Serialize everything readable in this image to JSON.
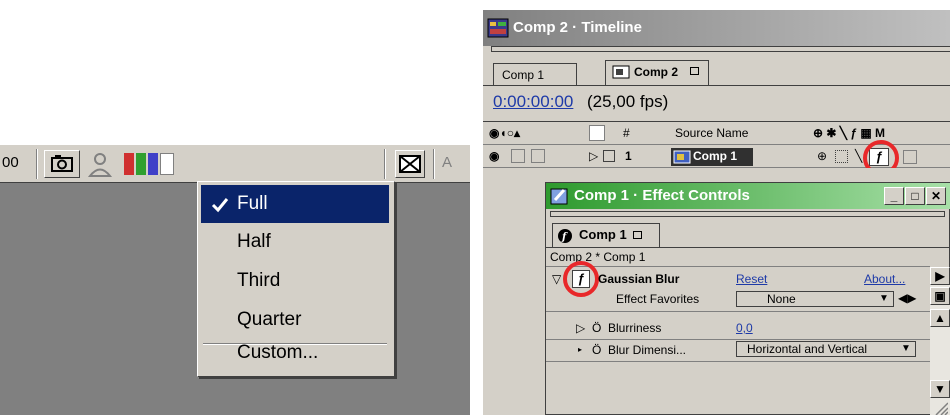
{
  "left_panel": {
    "toolbar": {
      "zoom_partial": "00",
      "snapshot_icon": "camera-icon",
      "user_icon": "user-icon",
      "channel_colors": [
        "#d03030",
        "#30a030",
        "#4040c8"
      ],
      "mail_icon": "envelope-icon",
      "partial_label": "A"
    },
    "resolution_menu": {
      "items": [
        {
          "label": "Full",
          "checked": true
        },
        {
          "label": "Half",
          "checked": false
        },
        {
          "label": "Third",
          "checked": false
        },
        {
          "label": "Quarter",
          "checked": false
        }
      ],
      "custom_label": "Custom..."
    }
  },
  "timeline": {
    "title": "Comp 2 · Timeline",
    "tabs": [
      {
        "label": "Comp 1"
      },
      {
        "label": "Comp 2"
      }
    ],
    "timecode": "0:00:00:00",
    "fps": "(25,00 fps)",
    "header": {
      "source_name": "Source Name",
      "number": "#"
    },
    "layer": {
      "index": "1",
      "name": "Comp 1"
    }
  },
  "effect_controls": {
    "title": "Comp 1 · Effect Controls",
    "tab_label": "Comp 1",
    "breadcrumb": "Comp 2 * Comp 1",
    "effect": {
      "name": "Gaussian Blur",
      "reset": "Reset",
      "about": "About...",
      "favorites_label": "Effect Favorites",
      "favorites_value": "None"
    },
    "params": [
      {
        "label": "Blurriness",
        "value": "0,0"
      },
      {
        "label": "Blur Dimensi...",
        "value": "Horizontal and Vertical"
      }
    ]
  },
  "colors": {
    "menu_highlight": "#0a246a",
    "effect_title_green": "#2e9a2e",
    "timecode_blue": "#1e3aa8",
    "annotation_red": "#e8282a"
  }
}
